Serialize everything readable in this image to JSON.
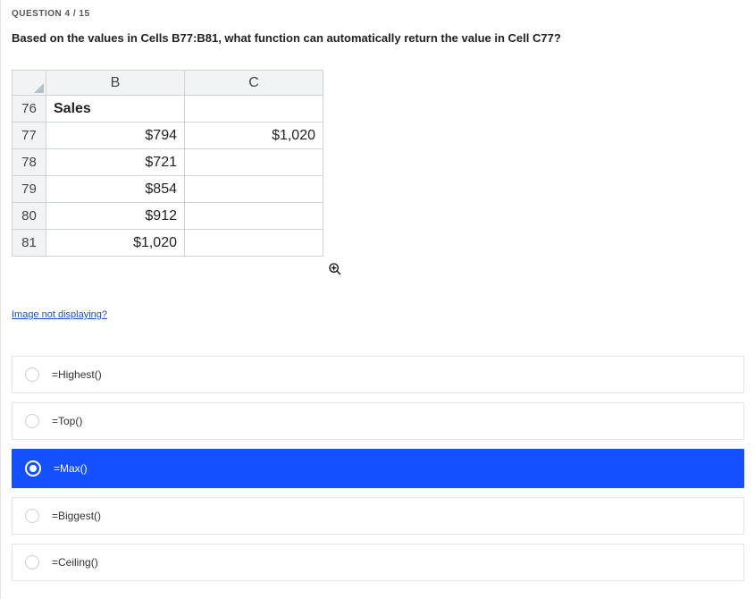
{
  "question_counter": "QUESTION 4 / 15",
  "question_text": "Based on the values in Cells B77:B81, what function can automatically return the value in Cell C77?",
  "spreadsheet": {
    "col_headers": [
      "B",
      "C"
    ],
    "rows": [
      {
        "num": "76",
        "b": "Sales",
        "b_align": "left",
        "c": ""
      },
      {
        "num": "77",
        "b": "$794",
        "b_align": "right",
        "c": "$1,020"
      },
      {
        "num": "78",
        "b": "$721",
        "b_align": "right",
        "c": ""
      },
      {
        "num": "79",
        "b": "$854",
        "b_align": "right",
        "c": ""
      },
      {
        "num": "80",
        "b": "$912",
        "b_align": "right",
        "c": ""
      },
      {
        "num": "81",
        "b": "$1,020",
        "b_align": "right",
        "c": ""
      }
    ]
  },
  "image_link": "Image not displaying?",
  "options": [
    {
      "label": "=Highest()",
      "selected": false
    },
    {
      "label": "=Top()",
      "selected": false
    },
    {
      "label": "=Max()",
      "selected": true
    },
    {
      "label": "=Biggest()",
      "selected": false
    },
    {
      "label": "=Ceiling()",
      "selected": false
    }
  ],
  "chart_data": {
    "type": "table",
    "title": "Spreadsheet excerpt B76:C81",
    "columns": [
      "Row",
      "B",
      "C"
    ],
    "rows": [
      [
        "76",
        "Sales",
        ""
      ],
      [
        "77",
        "$794",
        "$1,020"
      ],
      [
        "78",
        "$721",
        ""
      ],
      [
        "79",
        "$854",
        ""
      ],
      [
        "80",
        "$912",
        ""
      ],
      [
        "81",
        "$1,020",
        ""
      ]
    ]
  }
}
